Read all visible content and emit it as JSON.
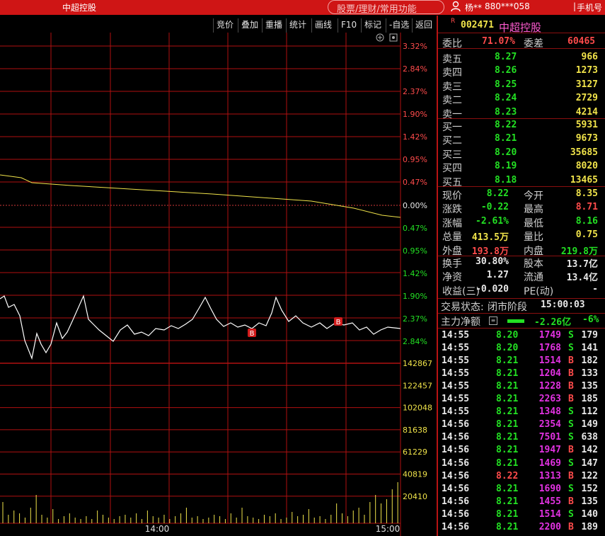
{
  "titlebar": {
    "title": "中超控股",
    "search_placeholder": "股票/理财/常用功能",
    "user_name": "杨**",
    "user_account": "880***058",
    "phone_label": "手机号"
  },
  "toolbar": {
    "items": [
      "竞价",
      "叠加",
      "重播",
      "统计",
      "画线",
      "F10",
      "标记",
      "-自选",
      "返回"
    ]
  },
  "chart": {
    "price_ticks_up": [
      "3.32%",
      "2.84%",
      "2.37%",
      "1.90%",
      "1.42%",
      "0.95%",
      "0.47%"
    ],
    "price_tick_zero": "0.00%",
    "price_ticks_down": [
      "0.47%",
      "0.95%",
      "1.42%",
      "1.90%",
      "2.37%",
      "2.84%"
    ],
    "volume_ticks": [
      "142867",
      "122457",
      "102048",
      "81638",
      "61229",
      "40819",
      "20410"
    ],
    "time_labels": [
      "14:00",
      "15:00"
    ],
    "trade_markers": [
      "B",
      "B"
    ],
    "colors": {
      "grid": "#b01111",
      "avg_line": "#f0e34a",
      "price_line": "#ffffff",
      "volume": "#f0e34a"
    },
    "icons": [
      "add-icon",
      "gear-icon"
    ]
  },
  "stock": {
    "badge": "R",
    "code": "002471",
    "name": "中超控股"
  },
  "order_stats": {
    "wei_bi_label": "委比",
    "wei_bi": "71.07%",
    "wei_cha_label": "委差",
    "wei_cha": "60465"
  },
  "asks": [
    {
      "label": "卖五",
      "price": "8.27",
      "vol": "966"
    },
    {
      "label": "卖四",
      "price": "8.26",
      "vol": "1273"
    },
    {
      "label": "卖三",
      "price": "8.25",
      "vol": "3127"
    },
    {
      "label": "卖二",
      "price": "8.24",
      "vol": "2729"
    },
    {
      "label": "卖一",
      "price": "8.23",
      "vol": "4214"
    }
  ],
  "bids": [
    {
      "label": "买一",
      "price": "8.22",
      "vol": "5931"
    },
    {
      "label": "买二",
      "price": "8.21",
      "vol": "9673"
    },
    {
      "label": "买三",
      "price": "8.20",
      "vol": "35685"
    },
    {
      "label": "买四",
      "price": "8.19",
      "vol": "8020"
    },
    {
      "label": "买五",
      "price": "8.18",
      "vol": "13465"
    }
  ],
  "quote": [
    {
      "l1": "现价",
      "v1": "8.22",
      "c1": "green",
      "l2": "今开",
      "v2": "8.35",
      "c2": "yellow"
    },
    {
      "l1": "涨跌",
      "v1": "-0.22",
      "c1": "green",
      "l2": "最高",
      "v2": "8.71",
      "c2": "red"
    },
    {
      "l1": "涨幅",
      "v1": "-2.61%",
      "c1": "green",
      "l2": "最低",
      "v2": "8.16",
      "c2": "green"
    },
    {
      "l1": "总量",
      "v1": "413.5万",
      "c1": "yellow",
      "l2": "量比",
      "v2": "0.75",
      "c2": "yellow"
    },
    {
      "l1": "外盘",
      "v1": "193.8万",
      "c1": "red",
      "l2": "内盘",
      "v2": "219.8万",
      "c2": "green"
    }
  ],
  "fundamentals": [
    {
      "l1": "换手",
      "v1": "30.80%",
      "l2": "股本",
      "v2": "13.7亿"
    },
    {
      "l1": "净资",
      "v1": "1.27",
      "l2": "流通",
      "v2": "13.4亿"
    },
    {
      "l1": "收益(三)",
      "v1": "-0.020",
      "l2": "PE(动)",
      "v2": "-"
    }
  ],
  "status": {
    "label": "交易状态:",
    "value": "闭市阶段",
    "time": "15:00:03"
  },
  "main_flow": {
    "label": "主力净额",
    "value": "-2.26亿",
    "pct": "-6%"
  },
  "ticks": [
    {
      "time": "14:55",
      "price": "8.20",
      "vol": "1749",
      "side": "S",
      "count": "179"
    },
    {
      "time": "14:55",
      "price": "8.20",
      "vol": "1768",
      "side": "S",
      "count": "141"
    },
    {
      "time": "14:55",
      "price": "8.21",
      "vol": "1514",
      "side": "B",
      "count": "182"
    },
    {
      "time": "14:55",
      "price": "8.21",
      "vol": "1204",
      "side": "B",
      "count": "133"
    },
    {
      "time": "14:55",
      "price": "8.21",
      "vol": "1228",
      "side": "B",
      "count": "135"
    },
    {
      "time": "14:55",
      "price": "8.21",
      "vol": "2263",
      "side": "B",
      "count": "185"
    },
    {
      "time": "14:55",
      "price": "8.21",
      "vol": "1348",
      "side": "S",
      "count": "112"
    },
    {
      "time": "14:56",
      "price": "8.21",
      "vol": "2354",
      "side": "S",
      "count": "149"
    },
    {
      "time": "14:56",
      "price": "8.21",
      "vol": "7501",
      "side": "S",
      "count": "638"
    },
    {
      "time": "14:56",
      "price": "8.21",
      "vol": "1947",
      "side": "B",
      "count": "142"
    },
    {
      "time": "14:56",
      "price": "8.21",
      "vol": "1469",
      "side": "S",
      "count": "147"
    },
    {
      "time": "14:56",
      "price": "8.22",
      "vol": "1313",
      "side": "B",
      "count": "122"
    },
    {
      "time": "14:56",
      "price": "8.21",
      "vol": "1690",
      "side": "S",
      "count": "152"
    },
    {
      "time": "14:56",
      "price": "8.21",
      "vol": "1455",
      "side": "B",
      "count": "135"
    },
    {
      "time": "14:56",
      "price": "8.21",
      "vol": "1514",
      "side": "S",
      "count": "140"
    },
    {
      "time": "14:56",
      "price": "8.21",
      "vol": "2200",
      "side": "B",
      "count": "189"
    }
  ]
}
